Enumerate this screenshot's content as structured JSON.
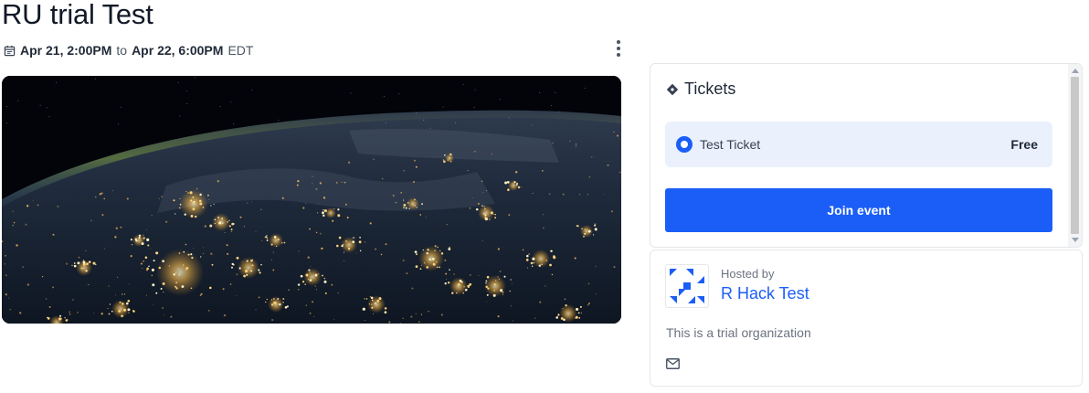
{
  "event": {
    "title": "RU trial Test",
    "start": "Apr 21, 2:00PM",
    "connector": "to",
    "end": "Apr 22, 6:00PM",
    "timezone": "EDT",
    "date_icon": "calendar-icon",
    "more_icon": "more-vertical-icon",
    "hero_image": "earth-at-night-from-space"
  },
  "tickets": {
    "heading": "Tickets",
    "heading_icon": "ticket-icon",
    "options": [
      {
        "name": "Test Ticket",
        "price": "Free",
        "selected": true
      }
    ],
    "join_label": "Join event"
  },
  "host": {
    "hosted_by_label": "Hosted by",
    "name": "R Hack Test",
    "description": "This is a trial organization",
    "contact_icon": "mail-icon"
  },
  "colors": {
    "accent": "#1b5ef7",
    "ticket_bg": "#eaf1fd",
    "border": "#e5e7eb"
  }
}
